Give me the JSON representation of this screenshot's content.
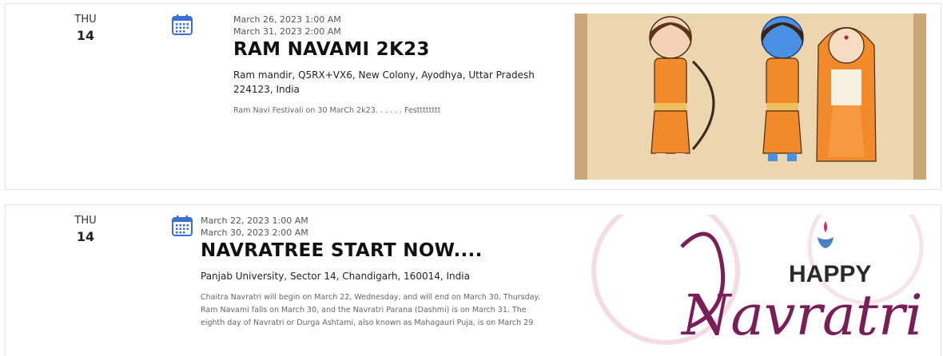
{
  "events": [
    {
      "weekday": "THU",
      "day": "14",
      "start": "March 26, 2023 1:00 AM",
      "end": "March 31, 2023 2:00 AM",
      "title": "RAM NAVAMI 2K23",
      "address": "Ram mandir, Q5RX+VX6, New Colony, Ayodhya, Uttar Pradesh 224123, India",
      "description": "Ram Navi Festivali on 30 MarCh 2k23. . . . . . Festttttttt",
      "image_icon": "ram-sita-cartoon-illustration"
    },
    {
      "weekday": "THU",
      "day": "14",
      "start": "March 22, 2023 1:00 AM",
      "end": "March 30, 2023 2:00 AM",
      "title": "NAVRATREE START NOW....",
      "address": "Panjab University, Sector 14, Chandigarh, 160014, India",
      "description": "Chaitra Navratri will begin on March 22, Wednesday, and will end on March 30, Thursday. Ram Navami falls on March 30, and the Navratri Parana (Dashmi) is on March 31. The eighth day of Navratri or Durga Ashtami, also known as Mahagauri Puja, is on March 29",
      "image_icon": "happy-navratri-graphic",
      "image_text": {
        "happy": "HAPPY",
        "navratri": "Navratri"
      }
    }
  ],
  "colors": {
    "calendar_icon": "#3b6fd4",
    "title": "#111111",
    "navratri_purple": "#7a1e58",
    "scroll_bg": "#e2c9a0"
  }
}
